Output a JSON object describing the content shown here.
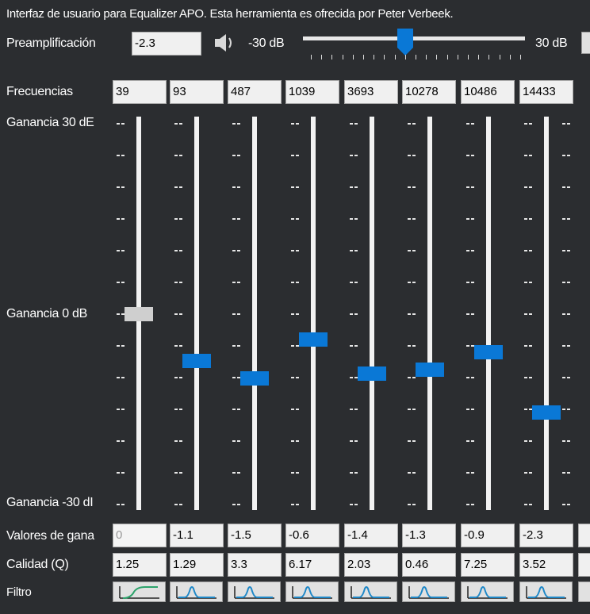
{
  "header": {
    "description": "Interfaz de usuario para Equalizer APO. Esta herramienta es ofrecida por Peter Verbeek."
  },
  "preamp": {
    "label": "Preamplificación",
    "value": "-2.3",
    "min_label": "-30 dB",
    "max_label": "30 dB",
    "slider_min": -30,
    "slider_max": 30,
    "slider_value": -2.3,
    "speaker_icon": "speaker-icon"
  },
  "labels": {
    "frequencies": "Frecuencias",
    "gain_top": "Ganancia 30 dE",
    "gain_mid": "Ganancia 0 dB",
    "gain_bottom": "Ganancia -30 dI",
    "gain_values": "Valores de gana",
    "quality": "Calidad (Q)",
    "filter": "Filtro"
  },
  "bands": [
    {
      "freq": "39",
      "gain": "0",
      "q": "1.25",
      "gain_value": 0,
      "filter_icon": "high-pass-filter-icon",
      "disabled": true
    },
    {
      "freq": "93",
      "gain": "-1.1",
      "q": "1.29",
      "gain_value": -1.1,
      "filter_icon": "peak-filter-icon",
      "disabled": false
    },
    {
      "freq": "487",
      "gain": "-1.5",
      "q": "3.3",
      "gain_value": -1.5,
      "filter_icon": "peak-filter-icon",
      "disabled": false
    },
    {
      "freq": "1039",
      "gain": "-0.6",
      "q": "6.17",
      "gain_value": -0.6,
      "filter_icon": "peak-filter-icon",
      "disabled": false
    },
    {
      "freq": "3693",
      "gain": "-1.4",
      "q": "2.03",
      "gain_value": -1.4,
      "filter_icon": "peak-filter-icon",
      "disabled": false
    },
    {
      "freq": "10278",
      "gain": "-1.3",
      "q": "0.46",
      "gain_value": -1.3,
      "filter_icon": "peak-filter-icon",
      "disabled": false
    },
    {
      "freq": "10486",
      "gain": "-0.9",
      "q": "7.25",
      "gain_value": -0.9,
      "filter_icon": "peak-filter-icon",
      "disabled": false
    },
    {
      "freq": "14433",
      "gain": "-2.3",
      "q": "3.52",
      "gain_value": -2.3,
      "filter_icon": "peak-filter-icon",
      "disabled": false
    }
  ],
  "gain_range": [
    -30,
    30
  ],
  "colors": {
    "background": "#2b2d30",
    "accent": "#0a78d6",
    "thumb_disabled": "#cfcfcf",
    "field_bg": "#f0f0f0",
    "filter_curve": "#1e88c8"
  }
}
